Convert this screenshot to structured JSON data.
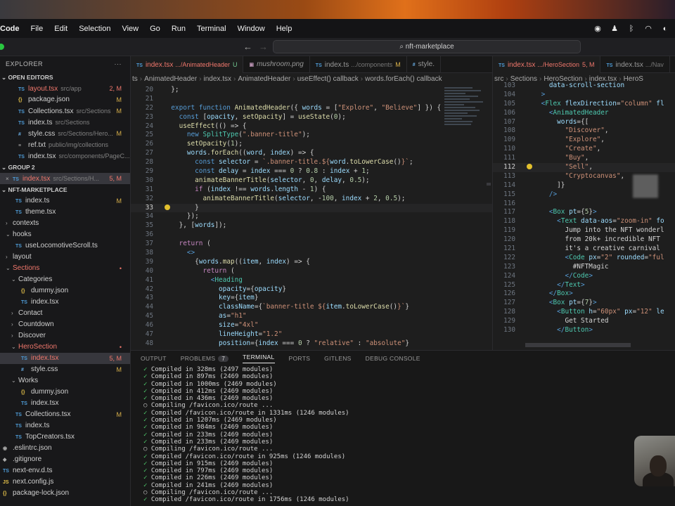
{
  "menubar": {
    "app": "Code",
    "items": [
      "File",
      "Edit",
      "Selection",
      "View",
      "Go",
      "Run",
      "Terminal",
      "Window",
      "Help"
    ]
  },
  "search": {
    "text": "nft-marketplace"
  },
  "sidebar": {
    "title": "EXPLORER",
    "open_editors": "OPEN EDITORS",
    "group2": "GROUP 2",
    "project": "NFT-MARKETPLACE",
    "open": [
      {
        "icon": "TS",
        "name": "layout.tsx",
        "path": "src/app",
        "status": "2, M",
        "red": true
      },
      {
        "icon": "{}",
        "name": "package.json",
        "path": "",
        "status": "M"
      },
      {
        "icon": "TS",
        "name": "Collections.tsx",
        "path": "src/Sections",
        "status": "M"
      },
      {
        "icon": "TS",
        "name": "index.ts",
        "path": "src/Sections",
        "status": ""
      },
      {
        "icon": "#",
        "name": "style.css",
        "path": "src/Sections/Hero...",
        "status": "M"
      },
      {
        "icon": "≡",
        "name": "ref.txt",
        "path": "public/img/collections",
        "status": ""
      },
      {
        "icon": "TS",
        "name": "index.tsx",
        "path": "src/components/PageC...",
        "status": ""
      }
    ],
    "group2_items": [
      {
        "icon": "TS",
        "name": "index.tsx",
        "path": "src/Sections/H...",
        "status": "5, M",
        "red": true
      }
    ],
    "tree": [
      {
        "lvl": 1,
        "icon": "TS",
        "name": "index.ts",
        "status": "M"
      },
      {
        "lvl": 1,
        "icon": "TS",
        "name": "theme.tsx",
        "status": ""
      },
      {
        "lvl": 0,
        "chev": "›",
        "name": "contexts",
        "status": ""
      },
      {
        "lvl": 0,
        "chev": "⌄",
        "name": "hooks",
        "status": ""
      },
      {
        "lvl": 1,
        "icon": "TS",
        "name": "useLocomotiveScroll.ts",
        "status": ""
      },
      {
        "lvl": 0,
        "chev": "›",
        "name": "layout",
        "status": ""
      },
      {
        "lvl": 0,
        "chev": "⌄",
        "name": "Sections",
        "status": "•",
        "red": true
      },
      {
        "lvl": 1,
        "chev": "⌄",
        "name": "Categories",
        "status": ""
      },
      {
        "lvl": 2,
        "icon": "{}",
        "name": "dummy.json",
        "status": ""
      },
      {
        "lvl": 2,
        "icon": "TS",
        "name": "index.tsx",
        "status": ""
      },
      {
        "lvl": 1,
        "chev": "›",
        "name": "Contact",
        "status": ""
      },
      {
        "lvl": 1,
        "chev": "›",
        "name": "Countdown",
        "status": ""
      },
      {
        "lvl": 1,
        "chev": "›",
        "name": "Discover",
        "status": ""
      },
      {
        "lvl": 1,
        "chev": "⌄",
        "name": "HeroSection",
        "status": "•",
        "red": true
      },
      {
        "lvl": 2,
        "icon": "TS",
        "name": "index.tsx",
        "status": "5, M",
        "red": true,
        "sel": true
      },
      {
        "lvl": 2,
        "icon": "#",
        "name": "style.css",
        "status": "M"
      },
      {
        "lvl": 1,
        "chev": "⌄",
        "name": "Works",
        "status": ""
      },
      {
        "lvl": 2,
        "icon": "{}",
        "name": "dummy.json",
        "status": ""
      },
      {
        "lvl": 2,
        "icon": "TS",
        "name": "index.tsx",
        "status": ""
      },
      {
        "lvl": 1,
        "icon": "TS",
        "name": "Collections.tsx",
        "status": "M"
      },
      {
        "lvl": 1,
        "icon": "TS",
        "name": "index.ts",
        "status": ""
      },
      {
        "lvl": 1,
        "icon": "TS",
        "name": "TopCreators.tsx",
        "status": ""
      },
      {
        "lvl": -1,
        "icon": "◉",
        "name": ".eslintrc.json",
        "status": ""
      },
      {
        "lvl": -1,
        "icon": "◆",
        "name": ".gitignore",
        "status": ""
      },
      {
        "lvl": -1,
        "icon": "TS",
        "name": "next-env.d.ts",
        "status": ""
      },
      {
        "lvl": -1,
        "icon": "JS",
        "name": "next.config.js",
        "status": ""
      },
      {
        "lvl": -1,
        "icon": "{}",
        "name": "package-lock.json",
        "status": ""
      }
    ]
  },
  "editor1": {
    "tabs": [
      {
        "name": "index.tsx",
        "sub": ".../AnimatedHeader",
        "mark": "U",
        "active": true
      },
      {
        "name": "mushroom.png",
        "sub": "",
        "mark": ""
      },
      {
        "name": "index.ts",
        "sub": ".../components",
        "mark": "M"
      },
      {
        "name": "style.",
        "sub": "",
        "mark": ""
      }
    ],
    "crumbs": [
      "ts",
      "AnimatedHeader",
      "index.tsx",
      "AnimatedHeader",
      "useEffect() callback",
      "words.forEach() callback"
    ]
  },
  "editor2": {
    "tabs": [
      {
        "name": "index.tsx",
        "sub": ".../HeroSection",
        "mark": "5, M",
        "active": true
      },
      {
        "name": "index.tsx",
        "sub": ".../Nav",
        "mark": ""
      }
    ],
    "crumbs": [
      "src",
      "Sections",
      "HeroSection",
      "index.tsx",
      "HeroS"
    ]
  },
  "panel": {
    "tabs": [
      "OUTPUT",
      "PROBLEMS",
      "TERMINAL",
      "PORTS",
      "GITLENS",
      "DEBUG CONSOLE"
    ],
    "problems_count": "7",
    "lines": [
      {
        "k": "ok",
        "t": "Compiled in 328ms (2497 modules)"
      },
      {
        "k": "ok",
        "t": "Compiled in 897ms (2469 modules)"
      },
      {
        "k": "ok",
        "t": "Compiled in 1000ms (2469 modules)"
      },
      {
        "k": "ok",
        "t": "Compiled in 412ms (2469 modules)"
      },
      {
        "k": "ok",
        "t": "Compiled in 436ms (2469 modules)"
      },
      {
        "k": "wait",
        "t": "Compiling /favicon.ico/route ..."
      },
      {
        "k": "ok",
        "t": "Compiled /favicon.ico/route in 1331ms (1246 modules)"
      },
      {
        "k": "ok",
        "t": "Compiled in 1207ms (2469 modules)"
      },
      {
        "k": "ok",
        "t": "Compiled in 984ms (2469 modules)"
      },
      {
        "k": "ok",
        "t": "Compiled in 233ms (2469 modules)"
      },
      {
        "k": "ok",
        "t": "Compiled in 233ms (2469 modules)"
      },
      {
        "k": "wait",
        "t": "Compiling /favicon.ico/route ..."
      },
      {
        "k": "ok",
        "t": "Compiled /favicon.ico/route in 925ms (1246 modules)"
      },
      {
        "k": "ok",
        "t": "Compiled in 915ms (2469 modules)"
      },
      {
        "k": "ok",
        "t": "Compiled in 797ms (2469 modules)"
      },
      {
        "k": "ok",
        "t": "Compiled in 226ms (2469 modules)"
      },
      {
        "k": "ok",
        "t": "Compiled in 241ms (2469 modules)"
      },
      {
        "k": "wait",
        "t": "Compiling /favicon.ico/route ..."
      },
      {
        "k": "ok",
        "t": "Compiled /favicon.ico/route in 1756ms (1246 modules)"
      }
    ]
  }
}
